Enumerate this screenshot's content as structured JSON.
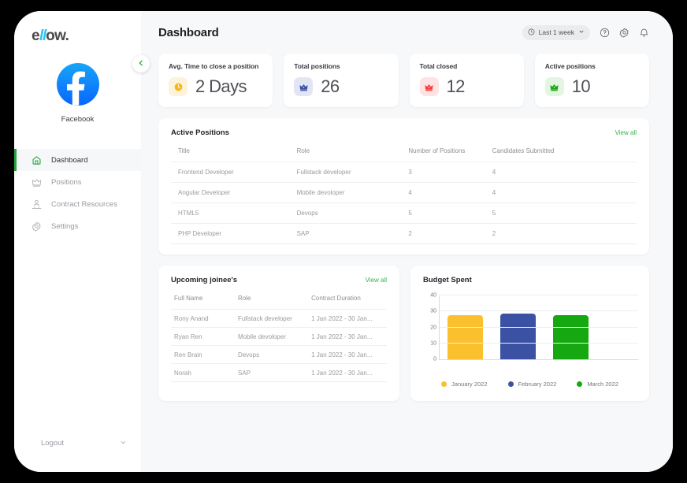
{
  "brand": {
    "name_pre": "e",
    "name_ll": "ll",
    "name_post": "ow."
  },
  "org": {
    "name": "Facebook",
    "avatar_icon": "facebook-icon"
  },
  "sidebar": {
    "items": [
      {
        "label": "Dashboard",
        "icon": "home-icon",
        "active": true
      },
      {
        "label": "Positions",
        "icon": "crown-icon",
        "active": false
      },
      {
        "label": "Contract Resources",
        "icon": "people-icon",
        "active": false
      },
      {
        "label": "Settings",
        "icon": "gear-icon",
        "active": false
      }
    ],
    "logout": {
      "label": "Logout",
      "icon": "logout-icon",
      "chevron": "chevron-down-icon"
    },
    "collapse": {
      "icon": "chevron-left-icon"
    }
  },
  "header": {
    "title": "Dashboard",
    "range": {
      "label": "Last 1 week",
      "icon": "clock-icon",
      "chevron": "chevron-down-icon"
    },
    "actions": [
      {
        "name": "help-icon"
      },
      {
        "name": "gear-icon"
      },
      {
        "name": "bell-icon"
      }
    ]
  },
  "stats": [
    {
      "label": "Avg. Time to close a position",
      "value": "2 Days",
      "icon": "clock-icon",
      "icon_color": "#f9b616",
      "icon_bg": "#fdf3da"
    },
    {
      "label": "Total positions",
      "value": "26",
      "icon": "crown-icon",
      "icon_color": "#3b51a3",
      "icon_bg": "#e2e5f4"
    },
    {
      "label": "Total closed",
      "value": "12",
      "icon": "crown-icon",
      "icon_color": "#fb3b3b",
      "icon_bg": "#fde3e3"
    },
    {
      "label": "Active positions",
      "value": "10",
      "icon": "crown-icon",
      "icon_color": "#16a810",
      "icon_bg": "#e3f6e2"
    }
  ],
  "active_positions": {
    "title": "Active Positions",
    "view_all": "View all",
    "columns": [
      "Title",
      "Role",
      "Number of Positions",
      "Candidates Submitted"
    ],
    "rows": [
      [
        "Frontend Developer",
        "Fullstack developer",
        "3",
        "4"
      ],
      [
        "Angular Developer",
        "Mobile devoloper",
        "4",
        "4"
      ],
      [
        "HTML5",
        "Devops",
        "5",
        "5"
      ],
      [
        "PHP Developer",
        "SAP",
        "2",
        "2"
      ]
    ]
  },
  "joinees": {
    "title": "Upcoming joinee's",
    "view_all": "View all",
    "columns": [
      "Full Name",
      "Role",
      "Contract Duration"
    ],
    "rows": [
      [
        "Rony Anand",
        "Fullstack developer",
        "1 Jan 2022 - 30 Jan..."
      ],
      [
        "Ryan Ren",
        "Mobile devoloper",
        "1 Jan 2022 - 30 Jan..."
      ],
      [
        "Ren Brain",
        "Devops",
        "1 Jan 2022 - 30 Jan..."
      ],
      [
        "Norah",
        "SAP",
        "1 Jan 2022 - 30 Jan..."
      ]
    ]
  },
  "budget": {
    "title": "Budget Spent"
  },
  "chart_data": {
    "type": "bar",
    "title": "Budget Spent",
    "categories": [
      "January 2022",
      "February 2022",
      "March 2022"
    ],
    "values": [
      27.5,
      28.5,
      27.5
    ],
    "colors": [
      "#fbc02d",
      "#3b51a3",
      "#16a810"
    ],
    "xlabel": "",
    "ylabel": "",
    "ylim": [
      0,
      40
    ],
    "yticks": [
      0,
      10,
      20,
      30,
      40
    ],
    "grid": true,
    "legend_position": "bottom"
  }
}
